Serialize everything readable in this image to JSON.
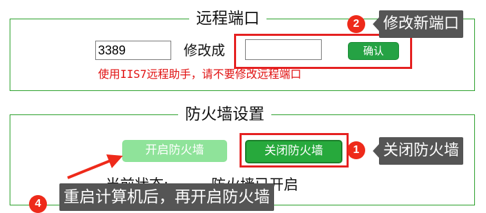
{
  "remote_port": {
    "title": "远程端口",
    "port_value": "3389",
    "modify_label": "修改成",
    "new_port_value": "",
    "confirm_label": "确认",
    "warning": "使用IIS7远程助手，请不要修改远程端口"
  },
  "firewall": {
    "title": "防火墙设置",
    "open_label": "开启防火墙",
    "close_label": "关闭防火墙",
    "status_label": "当前状态:",
    "status_value": "防火墙已开启"
  },
  "annotations": {
    "step1": {
      "number": "1",
      "text": "关闭防火墙"
    },
    "step2": {
      "number": "2",
      "text": "修改新端口"
    },
    "step4": {
      "number": "4",
      "text": "重启计算机后，再开启防火墙"
    }
  },
  "colors": {
    "group_border": "#2aa02a",
    "button_green": "#27a93c",
    "button_light_green": "#8fe39a",
    "highlight_red": "#e52020",
    "warning_red": "#e01010",
    "callout_gray": "#555555"
  }
}
